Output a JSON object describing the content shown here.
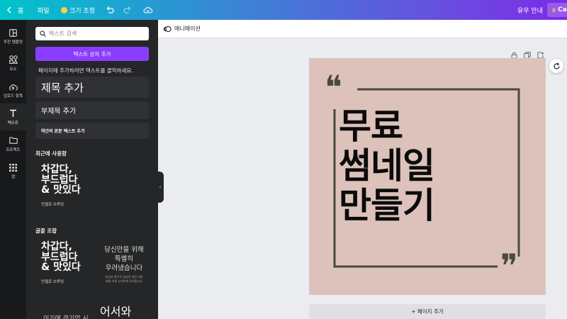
{
  "topbar": {
    "home_label": "홈",
    "file_label": "파일",
    "resize_label": "크기 조정",
    "paid_guide_label": "유무 안내",
    "share_label": "Ca"
  },
  "rail": {
    "items": [
      {
        "label": "추천 템플릿",
        "icon": "template-icon"
      },
      {
        "label": "요소",
        "icon": "elements-icon"
      },
      {
        "label": "업로드 항목",
        "icon": "upload-icon"
      },
      {
        "label": "텍스트",
        "icon": "text-icon"
      },
      {
        "label": "프로젝트",
        "icon": "folder-icon"
      },
      {
        "label": "앱",
        "icon": "apps-icon"
      }
    ]
  },
  "panel": {
    "search_placeholder": "텍스트 검색",
    "add_textbox_label": "텍스트 상자 추가",
    "hint": "페이지에 추가하려면 텍스트를 클릭하세요.",
    "heading_btn": "제목 추가",
    "subheading_btn": "부제목 추가",
    "body_btn": "약간의 본문 텍스트 추가",
    "recent_header": "최근에 사용함",
    "recent_tile": {
      "lines": [
        "차갑다,",
        "부드럽다",
        "& 맛있다"
      ],
      "caption": "안젤로 브루잉"
    },
    "combos_header": "글꼴 조합",
    "combo_tile_1": {
      "lines": [
        "차갑다,",
        "부드럽다",
        "& 맛있다"
      ],
      "caption": "안젤로 브루잉"
    },
    "combo_tile_2": {
      "lines": [
        "당신만을 위해",
        "특별히",
        "우려냈습니다"
      ],
      "small_1": "최상의 원두로 정성껏 내린 커피",
      "small_2": "매일 아침 신선하게 준비합니다"
    },
    "combo_tile_3_partial": "어서와",
    "combo_tile_4_partial": "이기에 큰기업 시"
  },
  "editor": {
    "animation_label": "애니메이션",
    "add_page_label": "+ 페이지 추가",
    "canvas": {
      "headline": [
        "무료",
        "썸네일",
        "만들기"
      ],
      "open_quote": "❝",
      "close_quote": "❞"
    }
  },
  "colors": {
    "canvas_bg": "#dcc2bb",
    "frame_line": "#4a4a3e",
    "headline": "#0b0b0b",
    "accent_purple": "#8b3dff"
  }
}
